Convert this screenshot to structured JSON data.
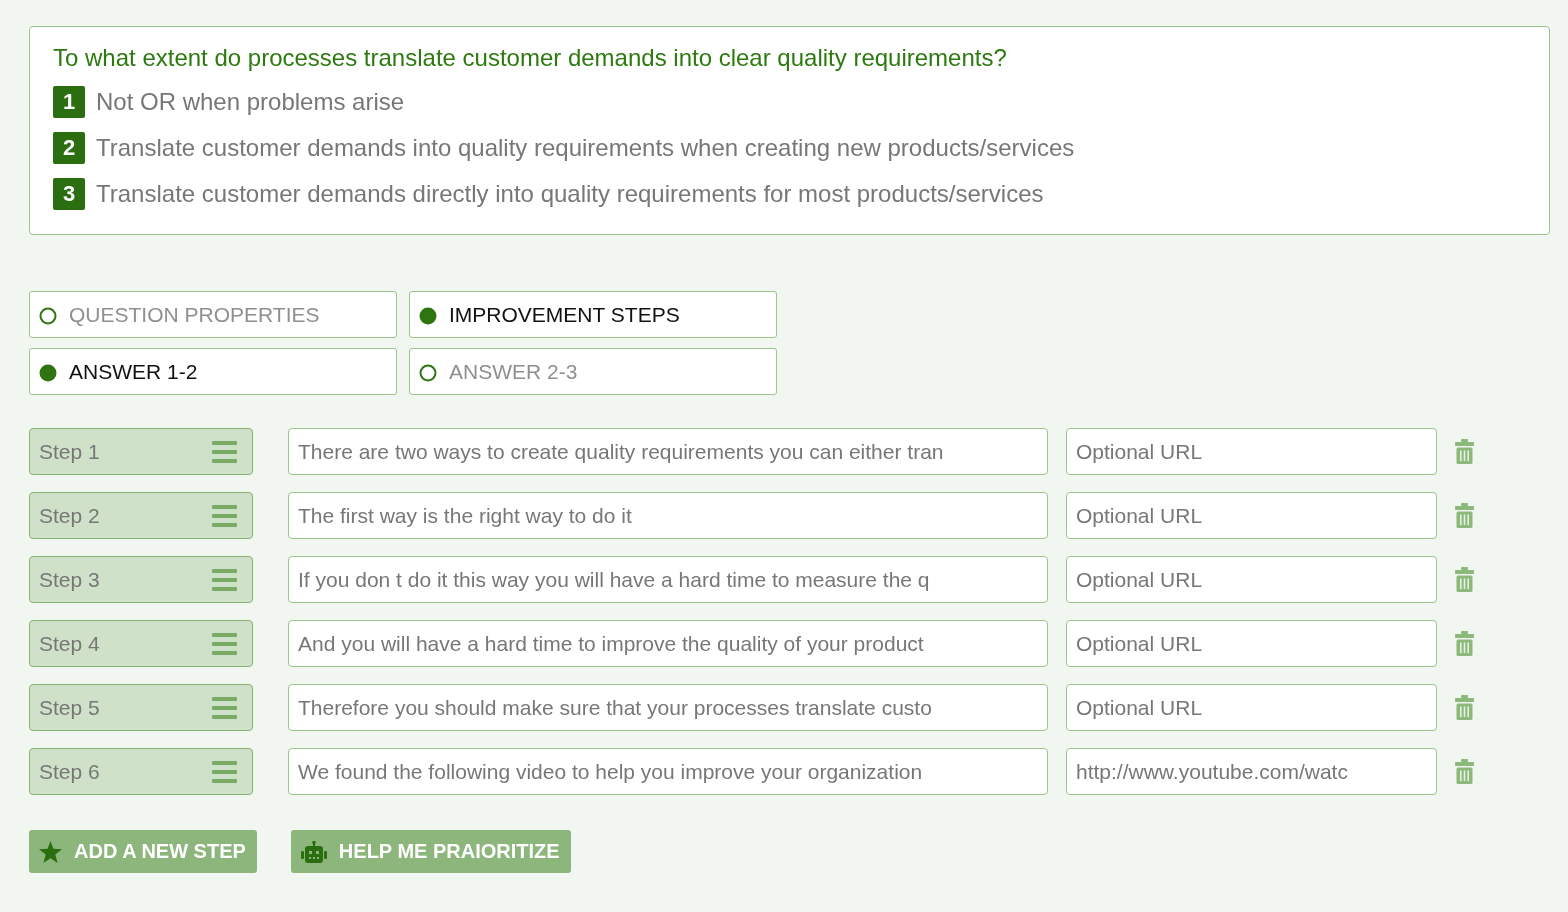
{
  "question": {
    "title": "To what extent do processes translate customer demands into clear quality requirements?",
    "options": [
      {
        "number": "1",
        "text": "Not OR when problems arise"
      },
      {
        "number": "2",
        "text": "Translate customer demands into quality requirements when creating new products/services"
      },
      {
        "number": "3",
        "text": "Translate customer demands directly into quality requirements for most products/services"
      }
    ]
  },
  "section_tabs": [
    {
      "label": "QUESTION PROPERTIES",
      "selected": false
    },
    {
      "label": "IMPROVEMENT STEPS",
      "selected": true
    }
  ],
  "answer_tabs": [
    {
      "label": "ANSWER 1-2",
      "selected": true
    },
    {
      "label": "ANSWER 2-3",
      "selected": false
    }
  ],
  "steps": [
    {
      "label": "Step 1",
      "description": {
        "value": "There are two ways to create quality requirements you can either tran"
      },
      "url": {
        "placeholder": "Optional URL"
      }
    },
    {
      "label": "Step 2",
      "description": {
        "value": "The first way is the right way to do it"
      },
      "url": {
        "placeholder": "Optional URL"
      }
    },
    {
      "label": "Step 3",
      "description": {
        "value": "If you don t do it this way you will have a hard time to measure the q"
      },
      "url": {
        "placeholder": "Optional URL"
      }
    },
    {
      "label": "Step 4",
      "description": {
        "value": "And you will have a hard time to improve the quality of your product"
      },
      "url": {
        "placeholder": "Optional URL"
      }
    },
    {
      "label": "Step 5",
      "description": {
        "value": "Therefore you should make sure that your processes translate custo"
      },
      "url": {
        "placeholder": "Optional URL"
      }
    },
    {
      "label": "Step 6",
      "description": {
        "value": "We found the following video to help you improve your organization"
      },
      "url": {
        "value": "http://www.youtube.com/watc"
      }
    }
  ],
  "buttons": [
    {
      "label": "ADD A NEW STEP",
      "kind": "add"
    },
    {
      "label": "HELP ME PRAIORITIZE",
      "kind": "prioritize"
    }
  ]
}
